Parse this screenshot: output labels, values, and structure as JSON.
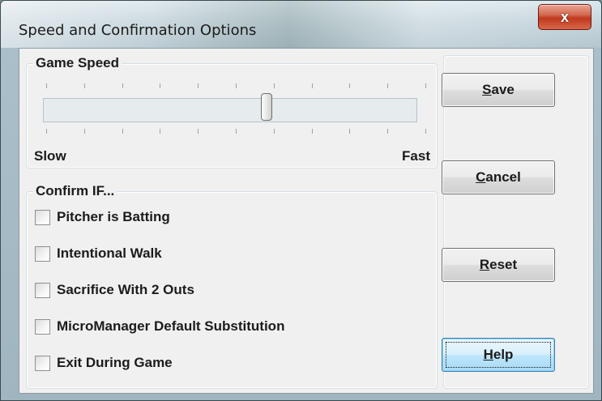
{
  "window": {
    "title": "Speed and Confirmation Options",
    "close_glyph": "x"
  },
  "speed": {
    "group_label": "Game Speed",
    "slow_label": "Slow",
    "fast_label": "Fast",
    "tick_count": 11,
    "value_fraction": 0.6
  },
  "confirm": {
    "group_label": "Confirm IF...",
    "options": [
      {
        "label": "Pitcher is Batting",
        "checked": false
      },
      {
        "label": "Intentional Walk",
        "checked": false
      },
      {
        "label": "Sacrifice With 2 Outs",
        "checked": false
      },
      {
        "label": "MicroManager Default Substitution",
        "checked": false
      },
      {
        "label": "Exit During Game",
        "checked": false
      }
    ]
  },
  "buttons": {
    "save": {
      "mnemonic": "S",
      "rest": "ave"
    },
    "cancel": {
      "mnemonic": "C",
      "rest": "ancel"
    },
    "reset": {
      "mnemonic": "R",
      "rest": "eset"
    },
    "help": {
      "mnemonic": "H",
      "rest": "elp"
    }
  },
  "colors": {
    "close_button": "#c0391e",
    "default_button_border": "#3c7fb1"
  }
}
